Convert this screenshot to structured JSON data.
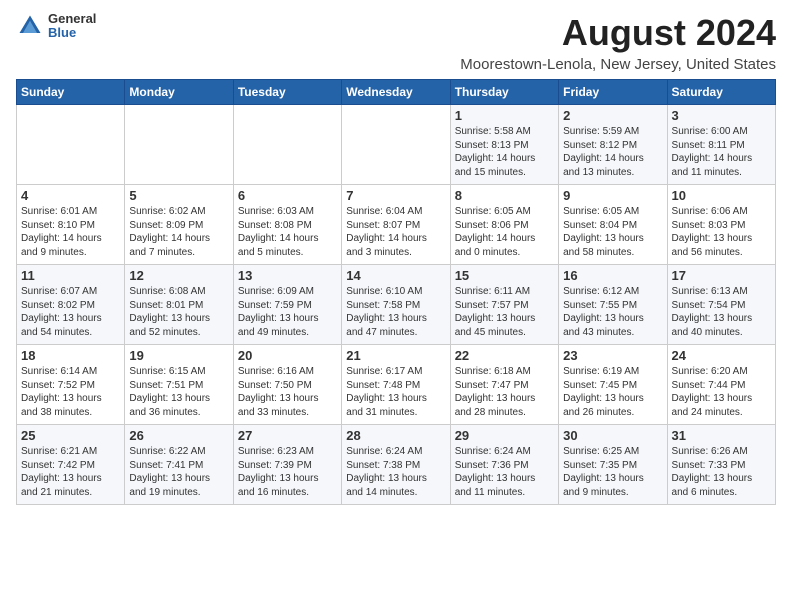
{
  "logo": {
    "general": "General",
    "blue": "Blue"
  },
  "title": "August 2024",
  "subtitle": "Moorestown-Lenola, New Jersey, United States",
  "columns": [
    "Sunday",
    "Monday",
    "Tuesday",
    "Wednesday",
    "Thursday",
    "Friday",
    "Saturday"
  ],
  "weeks": [
    [
      {
        "day": "",
        "info": ""
      },
      {
        "day": "",
        "info": ""
      },
      {
        "day": "",
        "info": ""
      },
      {
        "day": "",
        "info": ""
      },
      {
        "day": "1",
        "info": "Sunrise: 5:58 AM\nSunset: 8:13 PM\nDaylight: 14 hours\nand 15 minutes."
      },
      {
        "day": "2",
        "info": "Sunrise: 5:59 AM\nSunset: 8:12 PM\nDaylight: 14 hours\nand 13 minutes."
      },
      {
        "day": "3",
        "info": "Sunrise: 6:00 AM\nSunset: 8:11 PM\nDaylight: 14 hours\nand 11 minutes."
      }
    ],
    [
      {
        "day": "4",
        "info": "Sunrise: 6:01 AM\nSunset: 8:10 PM\nDaylight: 14 hours\nand 9 minutes."
      },
      {
        "day": "5",
        "info": "Sunrise: 6:02 AM\nSunset: 8:09 PM\nDaylight: 14 hours\nand 7 minutes."
      },
      {
        "day": "6",
        "info": "Sunrise: 6:03 AM\nSunset: 8:08 PM\nDaylight: 14 hours\nand 5 minutes."
      },
      {
        "day": "7",
        "info": "Sunrise: 6:04 AM\nSunset: 8:07 PM\nDaylight: 14 hours\nand 3 minutes."
      },
      {
        "day": "8",
        "info": "Sunrise: 6:05 AM\nSunset: 8:06 PM\nDaylight: 14 hours\nand 0 minutes."
      },
      {
        "day": "9",
        "info": "Sunrise: 6:05 AM\nSunset: 8:04 PM\nDaylight: 13 hours\nand 58 minutes."
      },
      {
        "day": "10",
        "info": "Sunrise: 6:06 AM\nSunset: 8:03 PM\nDaylight: 13 hours\nand 56 minutes."
      }
    ],
    [
      {
        "day": "11",
        "info": "Sunrise: 6:07 AM\nSunset: 8:02 PM\nDaylight: 13 hours\nand 54 minutes."
      },
      {
        "day": "12",
        "info": "Sunrise: 6:08 AM\nSunset: 8:01 PM\nDaylight: 13 hours\nand 52 minutes."
      },
      {
        "day": "13",
        "info": "Sunrise: 6:09 AM\nSunset: 7:59 PM\nDaylight: 13 hours\nand 49 minutes."
      },
      {
        "day": "14",
        "info": "Sunrise: 6:10 AM\nSunset: 7:58 PM\nDaylight: 13 hours\nand 47 minutes."
      },
      {
        "day": "15",
        "info": "Sunrise: 6:11 AM\nSunset: 7:57 PM\nDaylight: 13 hours\nand 45 minutes."
      },
      {
        "day": "16",
        "info": "Sunrise: 6:12 AM\nSunset: 7:55 PM\nDaylight: 13 hours\nand 43 minutes."
      },
      {
        "day": "17",
        "info": "Sunrise: 6:13 AM\nSunset: 7:54 PM\nDaylight: 13 hours\nand 40 minutes."
      }
    ],
    [
      {
        "day": "18",
        "info": "Sunrise: 6:14 AM\nSunset: 7:52 PM\nDaylight: 13 hours\nand 38 minutes."
      },
      {
        "day": "19",
        "info": "Sunrise: 6:15 AM\nSunset: 7:51 PM\nDaylight: 13 hours\nand 36 minutes."
      },
      {
        "day": "20",
        "info": "Sunrise: 6:16 AM\nSunset: 7:50 PM\nDaylight: 13 hours\nand 33 minutes."
      },
      {
        "day": "21",
        "info": "Sunrise: 6:17 AM\nSunset: 7:48 PM\nDaylight: 13 hours\nand 31 minutes."
      },
      {
        "day": "22",
        "info": "Sunrise: 6:18 AM\nSunset: 7:47 PM\nDaylight: 13 hours\nand 28 minutes."
      },
      {
        "day": "23",
        "info": "Sunrise: 6:19 AM\nSunset: 7:45 PM\nDaylight: 13 hours\nand 26 minutes."
      },
      {
        "day": "24",
        "info": "Sunrise: 6:20 AM\nSunset: 7:44 PM\nDaylight: 13 hours\nand 24 minutes."
      }
    ],
    [
      {
        "day": "25",
        "info": "Sunrise: 6:21 AM\nSunset: 7:42 PM\nDaylight: 13 hours\nand 21 minutes."
      },
      {
        "day": "26",
        "info": "Sunrise: 6:22 AM\nSunset: 7:41 PM\nDaylight: 13 hours\nand 19 minutes."
      },
      {
        "day": "27",
        "info": "Sunrise: 6:23 AM\nSunset: 7:39 PM\nDaylight: 13 hours\nand 16 minutes."
      },
      {
        "day": "28",
        "info": "Sunrise: 6:24 AM\nSunset: 7:38 PM\nDaylight: 13 hours\nand 14 minutes."
      },
      {
        "day": "29",
        "info": "Sunrise: 6:24 AM\nSunset: 7:36 PM\nDaylight: 13 hours\nand 11 minutes."
      },
      {
        "day": "30",
        "info": "Sunrise: 6:25 AM\nSunset: 7:35 PM\nDaylight: 13 hours\nand 9 minutes."
      },
      {
        "day": "31",
        "info": "Sunrise: 6:26 AM\nSunset: 7:33 PM\nDaylight: 13 hours\nand 6 minutes."
      }
    ]
  ]
}
